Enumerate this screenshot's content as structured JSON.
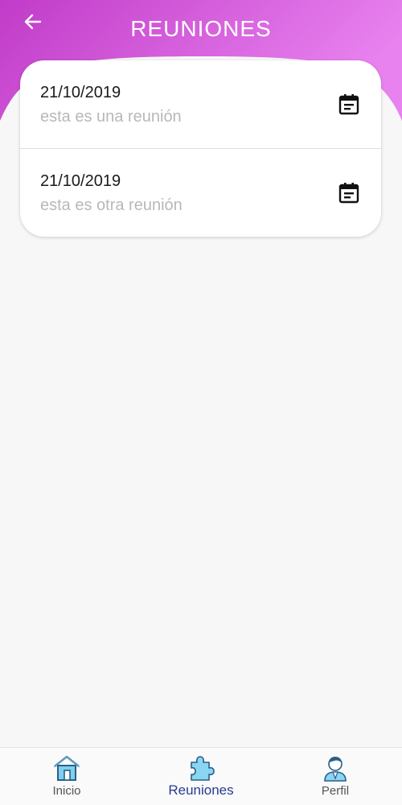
{
  "colors": {
    "header_gradient_start": "#c13bc8",
    "header_gradient_end": "#e882ef",
    "active_nav": "#2b3a8f",
    "inactive_nav": "#555555",
    "icon_blue": "#6ec6ea"
  },
  "header": {
    "title": "REUNIONES",
    "back_icon": "arrow-left-icon"
  },
  "meetings": [
    {
      "date": "21/10/2019",
      "description": "esta es una reunión",
      "icon": "calendar-icon"
    },
    {
      "date": "21/10/2019",
      "description": "esta es otra reunión",
      "icon": "calendar-icon"
    }
  ],
  "bottom_nav": {
    "items": [
      {
        "label": "Inicio",
        "icon": "home-icon",
        "active": false
      },
      {
        "label": "Reuniones",
        "icon": "puzzle-icon",
        "active": true
      },
      {
        "label": "Perfil",
        "icon": "user-icon",
        "active": false
      }
    ]
  }
}
